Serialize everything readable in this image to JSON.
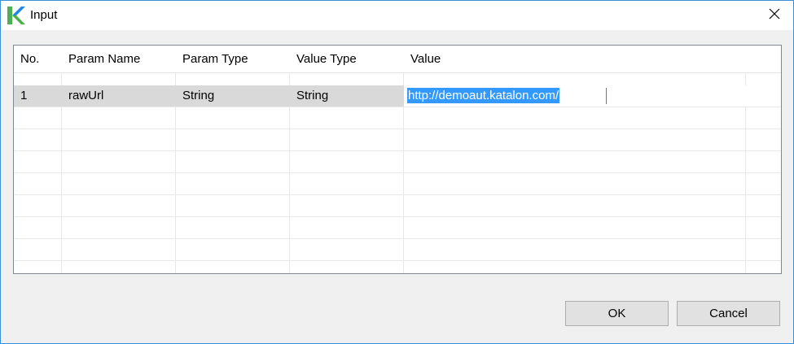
{
  "window": {
    "title": "Input"
  },
  "table": {
    "columns": [
      "No.",
      "Param Name",
      "Param Type",
      "Value Type",
      "Value"
    ],
    "rows": [
      {
        "no": "1",
        "param_name": "rawUrl",
        "param_type": "String",
        "value_type": "String",
        "value": "http://demoaut.katalon.com/"
      }
    ]
  },
  "buttons": {
    "ok": "OK",
    "cancel": "Cancel"
  },
  "colors": {
    "accent": "#3c8fd6",
    "selection": "#3399ff",
    "row_highlight": "#d9d9d9",
    "logo_green": "#4caf50",
    "logo_blue": "#1e88e5"
  },
  "icons": {
    "app": "katalon-logo-icon",
    "close": "close-icon"
  }
}
